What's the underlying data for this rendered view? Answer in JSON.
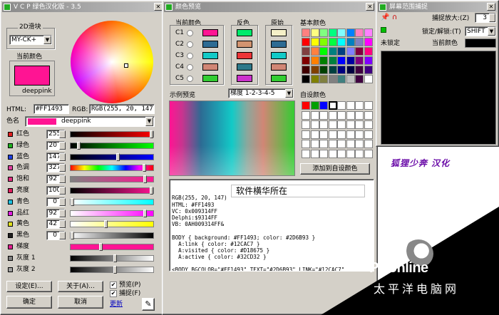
{
  "main_window": {
    "title": "V C P 绿色汉化版 - 3.5",
    "slider_group_label": "2D滑块",
    "slider_mode": "MY-CK+",
    "current_color_label": "当前颜色",
    "current_color_name": "deeppink",
    "current_color_hex": "#ff1493",
    "html_label": "HTML:",
    "html_value": "#FF1493",
    "rgb_label": "RGB:",
    "rgb_value": "RGB(255, 20, 147)",
    "color_name_label": "色名",
    "color_name_value": "deeppink",
    "channels": [
      {
        "label": "红色",
        "value": "255",
        "swatch": "#e02020",
        "fill": 1.0,
        "grad": "linear-gradient(90deg,#000 0%,#f00 100%)"
      },
      {
        "label": "绿色",
        "value": "20",
        "swatch": "#20b020",
        "fill": 0.08,
        "grad": "linear-gradient(90deg,#000,#0f0)"
      },
      {
        "label": "蓝色",
        "value": "147",
        "swatch": "#2040e0",
        "fill": 0.58,
        "grad": "linear-gradient(90deg,#000,#00f)"
      },
      {
        "label": "色调",
        "value": "327",
        "swatch": "#e040a0",
        "fill": 0.91,
        "grad": "linear-gradient(90deg,#f00,#ff0,#0f0,#0ff,#00f,#f0f,#f00)"
      },
      {
        "label": "饱和",
        "value": "92",
        "swatch": "#e03080",
        "fill": 0.92,
        "grad": "linear-gradient(90deg,#808080,#ff1493)"
      },
      {
        "label": "亮度",
        "value": "100",
        "swatch": "#e02060",
        "fill": 1.0,
        "grad": "linear-gradient(90deg,#000,#ff1493)"
      },
      {
        "label": "青色",
        "value": "0",
        "swatch": "#20c0e0",
        "fill": 0.0,
        "grad": "linear-gradient(90deg,#fff,#0ff)"
      },
      {
        "label": "品红",
        "value": "92",
        "swatch": "#e020e0",
        "fill": 0.92,
        "grad": "linear-gradient(90deg,#fff,#f0f)"
      },
      {
        "label": "黄色",
        "value": "42",
        "swatch": "#e0e020",
        "fill": 0.42,
        "grad": "linear-gradient(90deg,#fff,#ff0)"
      },
      {
        "label": "黑色",
        "value": "0",
        "swatch": "#202020",
        "fill": 0.0,
        "grad": "linear-gradient(90deg,#fff,#000)"
      }
    ],
    "extra_rows": [
      {
        "label": "梯度",
        "swatch": "#e02090",
        "grad": "linear-gradient(90deg,#ff1493,#ff1493)"
      },
      {
        "label": "灰度 1",
        "swatch": "#808080",
        "grad": "linear-gradient(90deg,#000,#fff)"
      },
      {
        "label": "灰度 2",
        "swatch": "#a0a0a0",
        "grad": "linear-gradient(90deg,#000,#fff)"
      }
    ],
    "settings_button": "设定(E)...",
    "about_button": "关于(A)...",
    "preview_check": "预览(P)",
    "capture_check": "捕捉(F)",
    "ok_button": "确定",
    "cancel_button": "取消",
    "update_link": "更新"
  },
  "preview_window": {
    "title": "颜色预览",
    "current_label": "当前颜色",
    "inverse_label": "反色",
    "original_label": "原始",
    "rows": [
      {
        "label": "C1",
        "current": "#ff1493",
        "inverse": "#00eb6c",
        "original": "#f5f0c8"
      },
      {
        "label": "C2",
        "current": "#2d6b93",
        "inverse": "#d29470",
        "original": "#2d6b93"
      },
      {
        "label": "C3",
        "current": "#12cac7",
        "inverse": "#ed3538",
        "original": "#12cac7"
      },
      {
        "label": "C4",
        "current": "#d18675",
        "inverse": "#2e798a",
        "original": "#d18675"
      },
      {
        "label": "C5",
        "current": "#32cd32",
        "inverse": "#cd32cd",
        "original": "#32cd32"
      }
    ],
    "basic_label": "基本颜色",
    "sample_label": "示例预览",
    "gradient_mode": "梯度 1-2-3-4-5",
    "custom_label": "自设颜色",
    "add_custom_button": "添加到自设颜色",
    "code_lines": [
      "RGB(255, 20, 147)",
      "HTML: #FF1493",
      "VC: 0x009314FF",
      "Delphi:$9314FF",
      "VB: 0AH009314FF&",
      "",
      "BODY { background: #FF1493; color: #2D6B93 }",
      "  A:link { color: #12CAC7 }",
      "  A:visited { color: #D18675 }",
      "  A:active { color: #32CD32 }",
      "",
      "<BODY BGCOLOR=\"#FF1493\" TEXT=\"#2D6B93\" LINK=\"#12CAC7\"",
      "VLINK=\"#D18675\" ALINK=\"#32CD32\">"
    ],
    "overlay_text": "软件横华所在"
  },
  "capture_window": {
    "title": "屏幕范围捕捉",
    "zoom_label": "捕捉放大:(Z)",
    "zoom_value": "3",
    "lock_label": "锁定/解锁:(T)",
    "lock_value": "SHIFT",
    "unlocked_label": "未锁定",
    "current_label": "当前颜色"
  },
  "watermark": {
    "brand": "PConline",
    "brand_cn": "太平洋电脑网",
    "caption": "狐狸少奔 汉化"
  }
}
